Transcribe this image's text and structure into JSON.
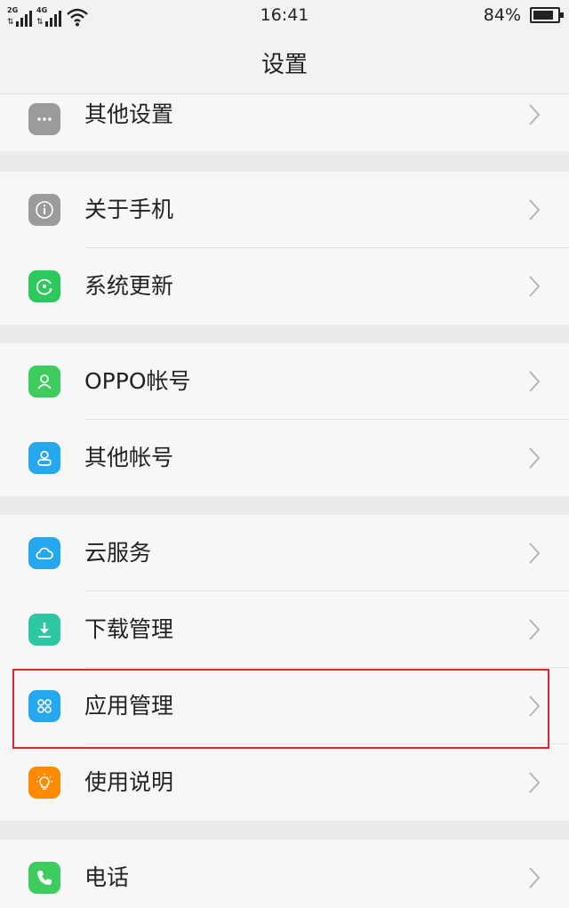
{
  "status_bar": {
    "sim1_network": "2G",
    "sim2_network": "4G",
    "time": "16:41",
    "battery_percent": "84%",
    "battery_level": 0.84
  },
  "header": {
    "title": "设置"
  },
  "colors": {
    "other_settings": "#9b9b9b",
    "about_phone": "#9b9b9b",
    "system_update": "#2ec95c",
    "oppo_account": "#3fcc5f",
    "other_accounts": "#26a8f0",
    "cloud_service": "#26a8f0",
    "download_manager": "#2dc7a3",
    "app_management": "#26a8f0",
    "user_guide": "#ff8a00",
    "phone": "#3fcc5f",
    "highlight": "#e0232e"
  },
  "settings": {
    "other_settings": {
      "label": "其他设置",
      "icon": "more-dots-icon"
    },
    "about_phone": {
      "label": "关于手机",
      "icon": "info-icon"
    },
    "system_update": {
      "label": "系统更新",
      "icon": "update-icon"
    },
    "oppo_account": {
      "label": "OPPO帐号",
      "icon": "account-icon"
    },
    "other_accounts": {
      "label": "其他帐号",
      "icon": "user-icon"
    },
    "cloud_service": {
      "label": "云服务",
      "icon": "cloud-icon"
    },
    "download_manager": {
      "label": "下载管理",
      "icon": "download-icon"
    },
    "app_management": {
      "label": "应用管理",
      "icon": "apps-grid-icon"
    },
    "user_guide": {
      "label": "使用说明",
      "icon": "lightbulb-icon"
    },
    "phone": {
      "label": "电话",
      "icon": "phone-icon"
    }
  }
}
